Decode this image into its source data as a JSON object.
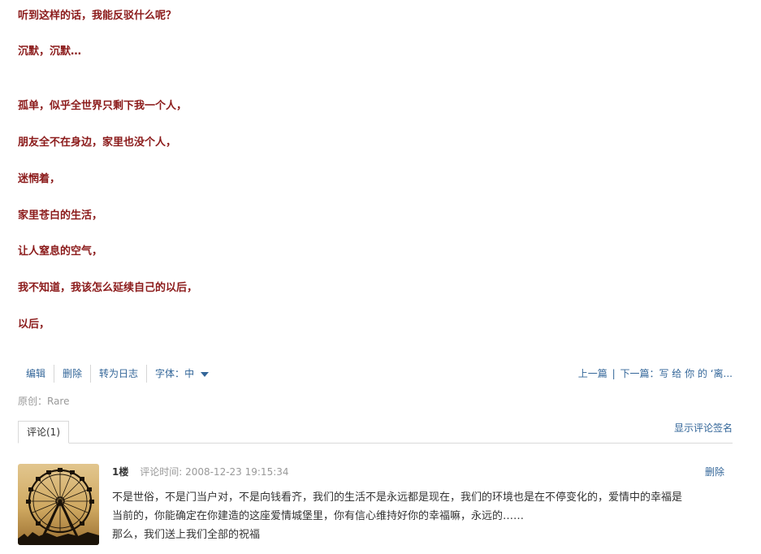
{
  "poem": {
    "lines": [
      "听到这样的话，我能反驳什么呢？",
      "沉默，沉默…",
      "孤单，似乎全世界只剩下我一个人，",
      "朋友全不在身边，家里也没个人，",
      "迷惘着，",
      "家里苍白的生活，",
      "让人窒息的空气，",
      "我不知道，我该怎么延续自己的以后，",
      "以后，"
    ]
  },
  "toolbar": {
    "edit": "编辑",
    "delete": "删除",
    "to_diary": "转为日志",
    "font_label": "字体：",
    "font_value": "中",
    "prev": "上一篇",
    "separator": "|",
    "next_label": "下一篇：",
    "next_title": "写 给 你 的 ‘离..."
  },
  "original": "原创：Rare",
  "comments_tab": {
    "label": "评论(1)",
    "show_signature": "显示评论签名"
  },
  "comment": {
    "floor": "1楼",
    "time_label": "评论时间:",
    "time": "2008-12-23 19:15:34",
    "delete": "删除",
    "text_line1": "不是世俗，不是门当户对，不是向钱看齐，我们的生活不是永远都是现在，我们的环境也是在不停变化的，爱情中的幸福是",
    "text_line2": "当前的，你能确定在你建造的这座爱情城堡里，你有信心维持好你的幸福嘛，永远的……",
    "text_line3": "那么，我们送上我们全部的祝福"
  },
  "colors": {
    "poem_text": "#8b1a1a",
    "link": "#336699",
    "muted": "#999999",
    "body_text": "#333333"
  },
  "icons": {
    "font_dropdown": "caret-down-icon",
    "avatar": "ferris-wheel-photo"
  }
}
